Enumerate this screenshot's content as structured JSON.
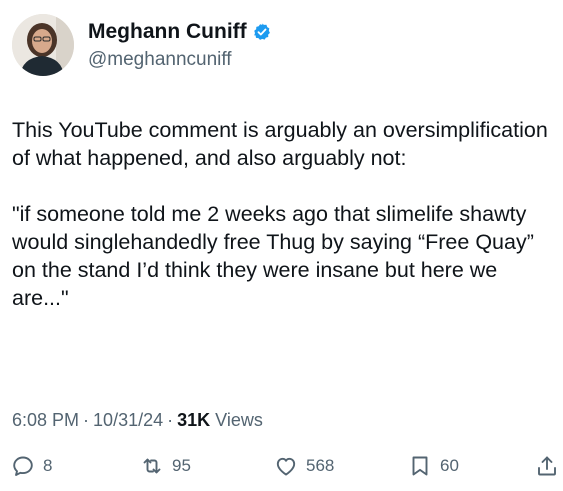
{
  "author": {
    "display_name": "Meghann Cuniff",
    "handle": "@meghanncuniff",
    "verified": true,
    "verified_color": "#1d9bf0"
  },
  "tweet": {
    "paragraphs": [
      "This YouTube comment is arguably an oversimplification of what happened, and also arguably not:",
      "\"if someone told me 2 weeks ago that slimelife shawty would singlehandedly free Thug by saying “Free Quay” on the stand I’d think they were insane but here we are...\""
    ]
  },
  "meta": {
    "time": "6:08 PM",
    "date": "10/31/24",
    "views_count": "31K",
    "views_label": "Views"
  },
  "actions": {
    "replies": "8",
    "reposts": "95",
    "likes": "568",
    "bookmarks": "60"
  },
  "icons": {
    "reply": "reply-icon",
    "repost": "repost-icon",
    "like": "heart-icon",
    "bookmark": "bookmark-icon",
    "share": "share-icon",
    "verified": "verified-badge-icon"
  }
}
